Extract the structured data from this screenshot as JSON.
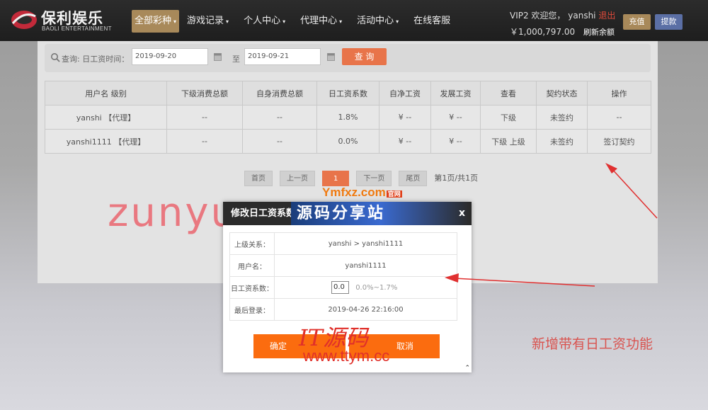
{
  "header": {
    "logo_text": "保利娱乐",
    "logo_sub": "BAOLI ENTERTAINMENT",
    "nav": [
      {
        "label": "全部彩种",
        "caret": "▾",
        "active": true
      },
      {
        "label": "游戏记录",
        "caret": "▾"
      },
      {
        "label": "个人中心",
        "caret": "▾"
      },
      {
        "label": "代理中心",
        "caret": "▾"
      },
      {
        "label": "活动中心",
        "caret": "▾"
      },
      {
        "label": "在线客服",
        "caret": ""
      }
    ],
    "greeting": "VIP2 欢迎您，",
    "username": "yanshi",
    "logout": "退出",
    "balance": "￥1,000,797.00",
    "refresh": "刷新余额",
    "recharge": "充值",
    "withdraw": "提款"
  },
  "query": {
    "label": "查询:",
    "time_label": "日工资时间：",
    "date_from": "2019-09-20",
    "to": "至",
    "date_to": "2019-09-21",
    "button": "查 询"
  },
  "table": {
    "headers": [
      "用户名  级别",
      "下级消费总额",
      "自身消费总额",
      "日工资系数",
      "自净工资",
      "发展工资",
      "查看",
      "契约状态",
      "操作"
    ],
    "rows": [
      [
        "yanshi  【代理】",
        "--",
        "--",
        "1.8%",
        "¥ --",
        "¥ --",
        "下级",
        "未签约",
        "--"
      ],
      [
        "yanshi1111  【代理】",
        "--",
        "--",
        "0.0%",
        "¥ --",
        "¥ --",
        "下级  上级",
        "未签约",
        "签订契约"
      ]
    ]
  },
  "pager": {
    "first": "首页",
    "prev": "上一页",
    "current": "1",
    "next": "下一页",
    "last": "尾页",
    "info": "第1页/共1页"
  },
  "dialog": {
    "title": "修改日工资系数",
    "close": "x",
    "rows": [
      {
        "key": "上级关系：",
        "value": "yanshi > yanshi1111"
      },
      {
        "key": "用户名：",
        "value": "yanshi1111"
      },
      {
        "key": "日工资系数：",
        "input": "0.0",
        "range": "0.0%~1.7%"
      },
      {
        "key": "最后登录：",
        "value": "2019-04-26 22:16:00"
      }
    ],
    "ok": "确定",
    "cancel": "取消"
  },
  "watermarks": {
    "domain": "zunyuanma.com",
    "ymfxz": "Ymfxz.com",
    "ymfxz_badge": "官网",
    "ymfxz_cn": "源码分享站",
    "it": "IT源码",
    "ttym": "www.ttym.cc"
  },
  "caption": "新增带有日工资功能",
  "colors": {
    "accent_orange": "#fb6c0f",
    "gold": "#a8895a",
    "red": "#d9534f"
  }
}
